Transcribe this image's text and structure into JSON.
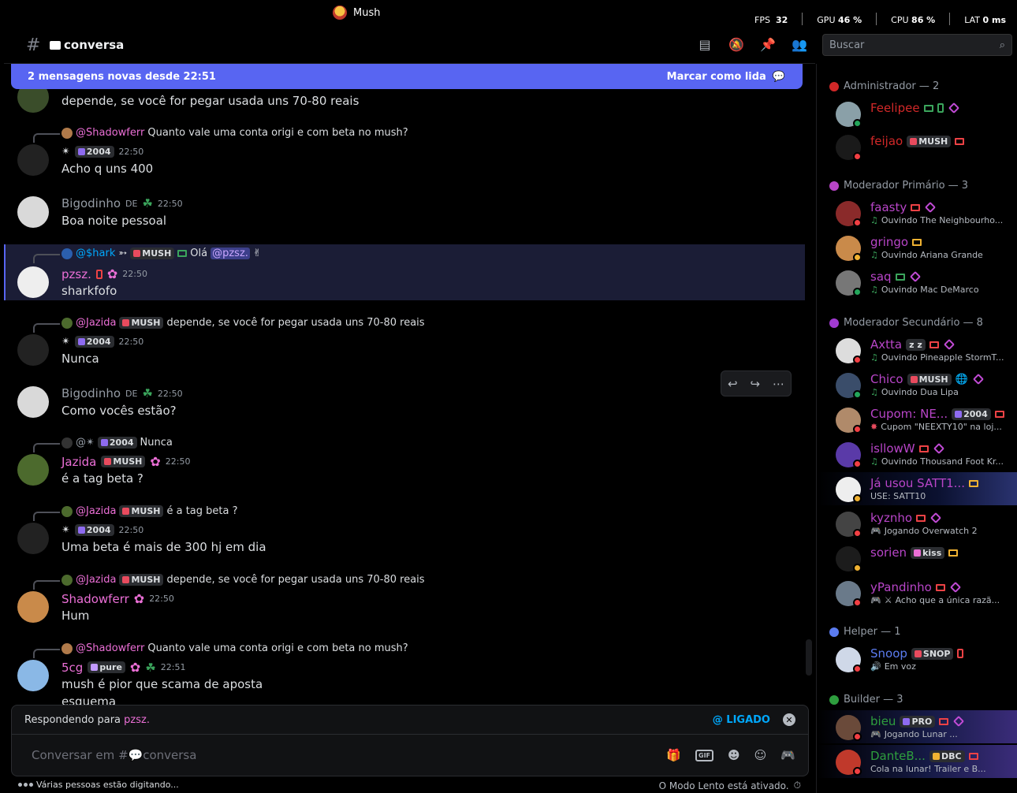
{
  "window": {
    "title": "Mush"
  },
  "hud": {
    "fps_label": "FPS",
    "fps": "32",
    "gpu_label": "GPU",
    "gpu": "46 %",
    "cpu_label": "CPU",
    "cpu": "86 %",
    "lat_label": "LAT",
    "lat": "0 ms"
  },
  "channel": {
    "hash": "#",
    "name": "conversa"
  },
  "search": {
    "placeholder": "Buscar"
  },
  "new_messages": {
    "text": "2 mensagens novas desde 22:51",
    "action": "Marcar como lida"
  },
  "messages": [
    {
      "body": "depende, se você for pegar usada uns 70-80 reais"
    },
    {
      "reply_name": "@Shadowferr",
      "reply_text": "Quanto vale uma conta origi e com beta no mush?",
      "tag": "2004",
      "time": "22:50",
      "body": "Acho q uns 400"
    },
    {
      "name": "Bigodinho",
      "flag": "DE",
      "time": "22:50",
      "body": "Boa noite pessoal"
    },
    {
      "reply_name": "@$hark",
      "reply_tag": "MUSH",
      "reply_text": "Olá",
      "reply_mention": "@pzsz.",
      "reply_emoji": "✌",
      "name": "pzsz.",
      "time": "22:50",
      "body": "sharkfofo"
    },
    {
      "reply_name": "@Jazida",
      "reply_tag": "MUSH",
      "reply_text": "depende, se você for pegar usada uns 70-80 reais",
      "tag": "2004",
      "time": "22:50",
      "body": "Nunca"
    },
    {
      "name": "Bigodinho",
      "flag": "DE",
      "time": "22:50",
      "body": "Como vocês estão?"
    },
    {
      "reply_name": "@✴",
      "reply_tag": "2004",
      "reply_text": "Nunca",
      "name": "Jazida",
      "tag": "MUSH",
      "time": "22:50",
      "body": "é a tag beta ?"
    },
    {
      "reply_name": "@Jazida",
      "reply_tag": "MUSH",
      "reply_text": "é a tag beta ?",
      "tag": "2004",
      "time": "22:50",
      "body": "Uma beta é mais de 300 hj em dia"
    },
    {
      "reply_name": "@Jazida",
      "reply_tag": "MUSH",
      "reply_text": "depende, se você for pegar usada uns 70-80 reais",
      "name": "Shadowferr",
      "time": "22:50",
      "body": "Hum"
    },
    {
      "reply_name": "@Shadowferr",
      "reply_text": "Quanto vale uma conta origi e com beta no mush?",
      "name": "5cg",
      "tag": "pure",
      "time": "22:51",
      "body": "mush é pior que scama de aposta",
      "body2": "esquema"
    }
  ],
  "reply_bar": {
    "prefix": "Respondendo para",
    "target": "pzsz.",
    "mention": "@ LIGADO"
  },
  "composer": {
    "placeholder": "Conversar em #💬conversa"
  },
  "typing": "Várias pessoas estão digitando...",
  "slowmode": "O Modo Lento está ativado.",
  "groups": [
    {
      "label": "Administrador — 2"
    },
    {
      "label": "Moderador Primário — 3"
    },
    {
      "label": "Moderador Secundário — 8"
    },
    {
      "label": "Helper — 1"
    },
    {
      "label": "Builder — 3"
    }
  ],
  "members": [
    {
      "name": "Feelipee"
    },
    {
      "name": "feijao",
      "tag": "MUSH"
    },
    {
      "name": "faasty",
      "activity": "Ouvindo The Neighbourho..."
    },
    {
      "name": "gringo",
      "activity": "Ouvindo Ariana Grande"
    },
    {
      "name": "saq",
      "activity": "Ouvindo Mac DeMarco"
    },
    {
      "name": "Axtta",
      "tag": "z z",
      "activity": "Ouvindo Pineapple StormT..."
    },
    {
      "name": "Chico",
      "tag": "MUSH",
      "activity": "Ouvindo Dua Lipa"
    },
    {
      "name": "Cupom: NE...",
      "tag": "2004",
      "activity": "Cupom \"NEEXTY10\" na loj..."
    },
    {
      "name": "isllowW",
      "activity": "Ouvindo Thousand Foot Kr..."
    },
    {
      "name": "Já usou SATT1...",
      "activity": "USE: SATT10"
    },
    {
      "name": "kyznho",
      "activity": "Jogando Overwatch 2"
    },
    {
      "name": "sorien",
      "tag": "kiss"
    },
    {
      "name": "yPandinho",
      "activity": "Acho que a única razã..."
    },
    {
      "name": "Snoop",
      "tag": "SNOP",
      "activity": "Em voz"
    },
    {
      "name": "bieu",
      "tag": "PRO",
      "activity": "Jogando Lunar ..."
    },
    {
      "name": "DanteB...",
      "tag": "DBC",
      "activity": "Cola na lunar! Trailer e B..."
    }
  ],
  "colors": {
    "accent": "#5865f2",
    "admin": "#d12828",
    "mod": "#b845c8",
    "helper": "#5b7cf0",
    "builder": "#2e9e3e"
  }
}
